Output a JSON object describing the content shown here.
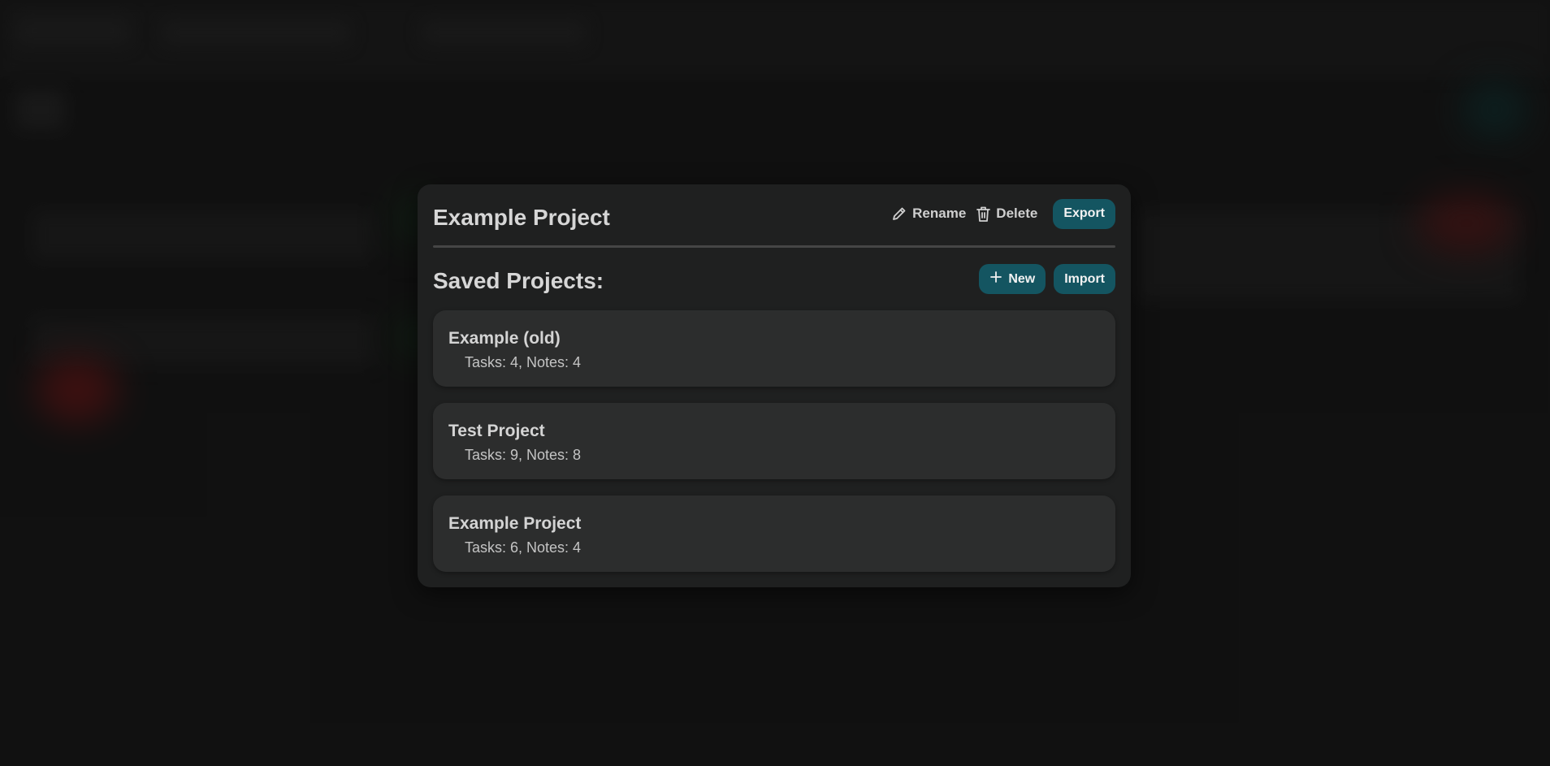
{
  "modal": {
    "title": "Example Project",
    "rename_label": "Rename",
    "delete_label": "Delete",
    "export_label": "Export"
  },
  "saved": {
    "title": "Saved Projects:",
    "new_label": "New",
    "import_label": "Import"
  },
  "projects": [
    {
      "name": "Example (old)",
      "meta": "Tasks: 4, Notes: 4"
    },
    {
      "name": "Test Project",
      "meta": "Tasks: 9, Notes: 8"
    },
    {
      "name": "Example Project",
      "meta": "Tasks: 6, Notes: 4"
    }
  ],
  "colors": {
    "accent": "#145561",
    "modal_bg": "#1f2020",
    "card_bg": "#2c2d2d"
  },
  "icons": {
    "rename": "pencil-icon",
    "delete": "trash-icon",
    "new": "plus-icon"
  }
}
